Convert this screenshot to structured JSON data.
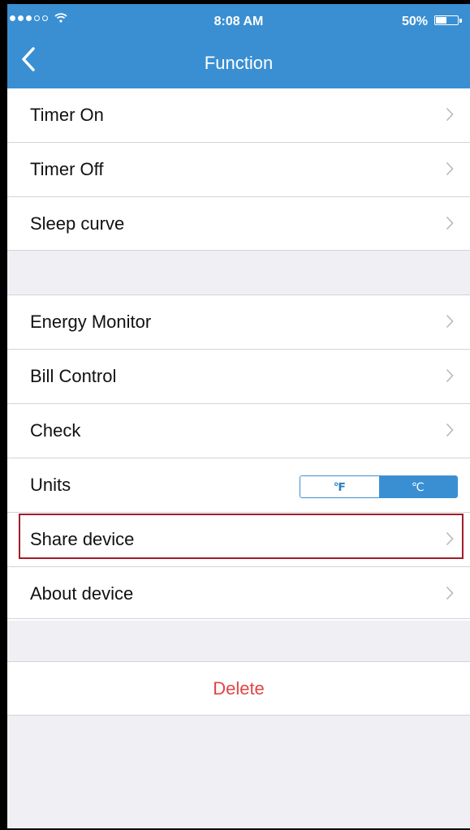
{
  "status_bar": {
    "time": "8:08 AM",
    "battery_percent": "50%",
    "signal_bars": 3,
    "battery_level": 0.5
  },
  "nav": {
    "title": "Function"
  },
  "groups": [
    {
      "items": [
        {
          "label": "Timer On"
        },
        {
          "label": "Timer Off"
        },
        {
          "label": "Sleep curve"
        }
      ]
    },
    {
      "items": [
        {
          "label": "Energy Monitor"
        },
        {
          "label": "Bill Control"
        },
        {
          "label": "Check"
        },
        {
          "label": "Units",
          "options": [
            "℉",
            "℃"
          ],
          "selected": "℃"
        },
        {
          "label": "Share device",
          "highlighted": true
        },
        {
          "label": "About device"
        }
      ]
    }
  ],
  "delete": {
    "label": "Delete"
  },
  "colors": {
    "header": "#3a8fd2",
    "delete_text": "#e24545",
    "highlight": "#a01e28",
    "background": "#efeff4"
  }
}
